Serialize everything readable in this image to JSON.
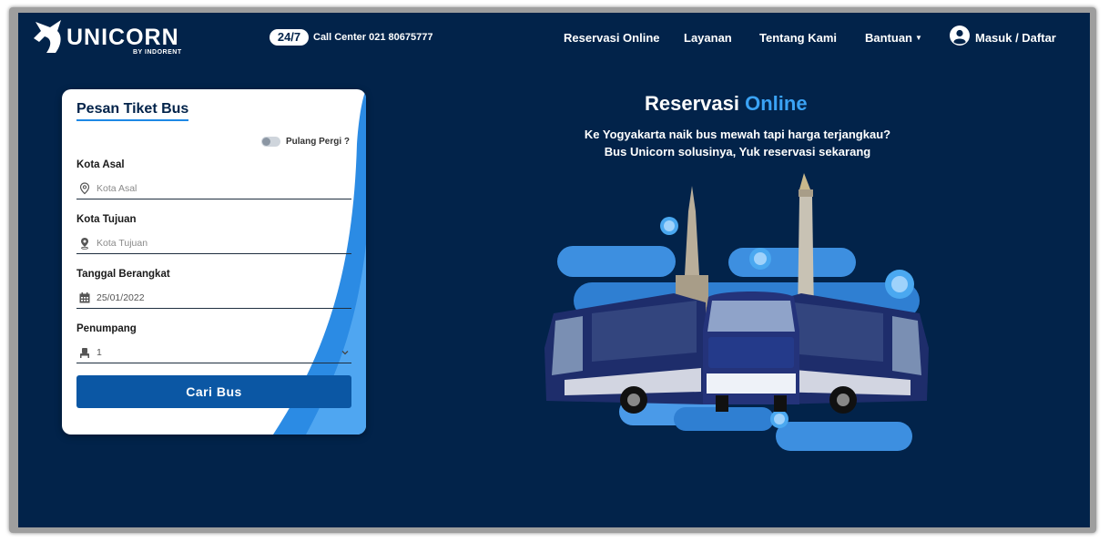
{
  "header": {
    "brand": "UNICORN",
    "brand_sub": "BY INDORENT",
    "badge": "24/7",
    "call_center": "Call Center 021 80675777",
    "nav": {
      "reservasi": "Reservasi Online",
      "layanan": "Layanan",
      "tentang": "Tentang Kami",
      "bantuan": "Bantuan",
      "masuk": "Masuk / Daftar"
    }
  },
  "form": {
    "title": "Pesan Tiket Bus",
    "round_trip_label": "Pulang Pergi ?",
    "round_trip_on": false,
    "origin_label": "Kota Asal",
    "origin_placeholder": "Kota Asal",
    "dest_label": "Kota Tujuan",
    "dest_placeholder": "Kota Tujuan",
    "date_label": "Tanggal Berangkat",
    "date_value": "25/01/2022",
    "passenger_label": "Penumpang",
    "passenger_value": "1",
    "submit": "Cari Bus"
  },
  "hero": {
    "title_main": "Reservasi",
    "title_accent": "Online",
    "line1": "Ke Yogyakarta naik bus mewah tapi harga terjangkau?",
    "line2": "Bus Unicorn solusinya, Yuk reservasi sekarang"
  },
  "colors": {
    "background": "#02234a",
    "accent": "#3aa3f5",
    "button": "#0b57a4"
  }
}
